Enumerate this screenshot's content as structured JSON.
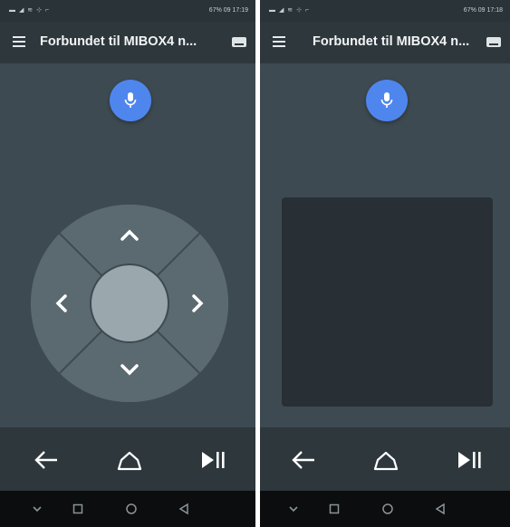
{
  "status_bar": {
    "left_icons": "▬ ◢ ≋ ⊹ ⌐",
    "left_right_text": "67% 09 17:19",
    "right_right_text": "67% 09 17:18"
  },
  "app_bar": {
    "menu_icon": "hamburger-menu-icon",
    "title": "Forbundet til MIBOX4 n...",
    "keyboard_icon": "keyboard-icon"
  },
  "voice": {
    "icon": "microphone-icon",
    "color": "#4f86ee"
  },
  "dpad": {
    "up_icon": "chevron-up-icon",
    "down_icon": "chevron-down-icon",
    "left_icon": "chevron-left-icon",
    "right_icon": "chevron-right-icon",
    "center": "select"
  },
  "touchpad": {
    "color": "#283035"
  },
  "bottom_controls": [
    "back-arrow-icon",
    "home-icon",
    "play-pause-icon"
  ],
  "nav_bar": [
    "nav-hide-icon",
    "nav-recents-icon",
    "nav-home-icon",
    "nav-back-icon"
  ],
  "colors": {
    "background": "#3d4a51",
    "app_bar": "#2d373c",
    "dpad_ring": "#5b6a71",
    "dpad_center": "#9aa7ad",
    "icon": "#ffffff"
  }
}
